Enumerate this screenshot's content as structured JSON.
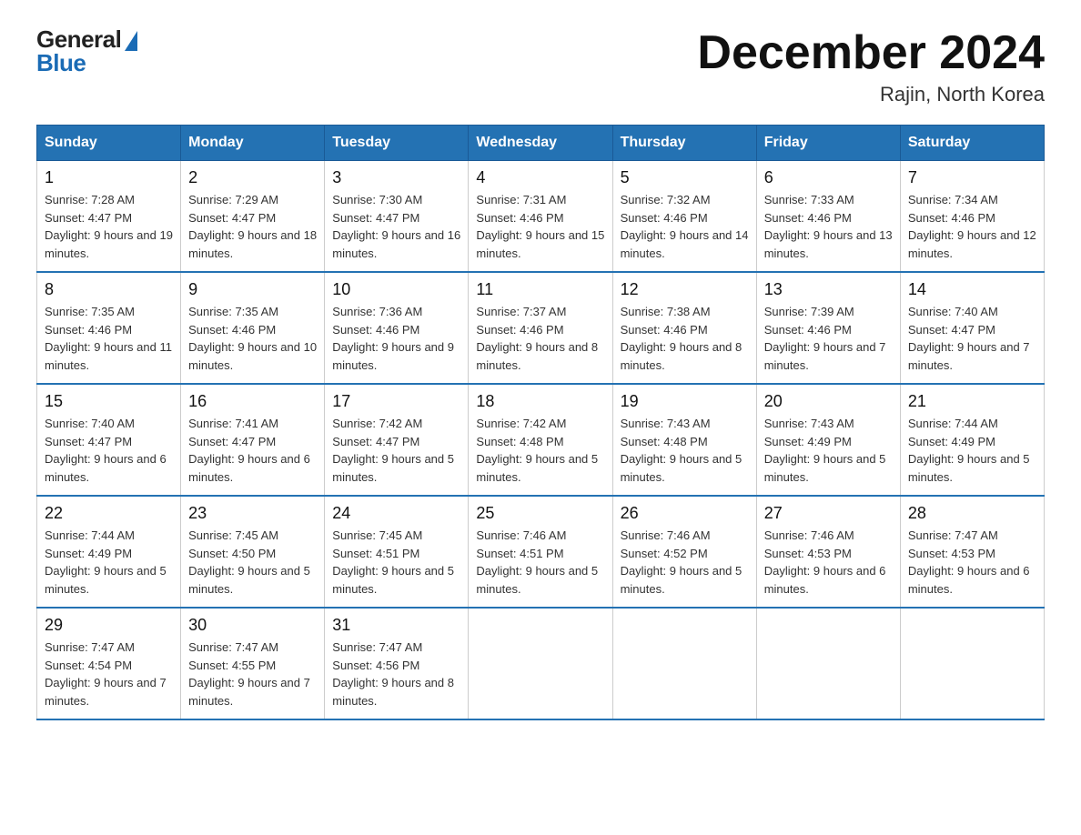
{
  "logo": {
    "general": "General",
    "blue": "Blue"
  },
  "title": "December 2024",
  "subtitle": "Rajin, North Korea",
  "days_of_week": [
    "Sunday",
    "Monday",
    "Tuesday",
    "Wednesday",
    "Thursday",
    "Friday",
    "Saturday"
  ],
  "weeks": [
    [
      {
        "day": "1",
        "sunrise": "7:28 AM",
        "sunset": "4:47 PM",
        "daylight": "9 hours and 19 minutes."
      },
      {
        "day": "2",
        "sunrise": "7:29 AM",
        "sunset": "4:47 PM",
        "daylight": "9 hours and 18 minutes."
      },
      {
        "day": "3",
        "sunrise": "7:30 AM",
        "sunset": "4:47 PM",
        "daylight": "9 hours and 16 minutes."
      },
      {
        "day": "4",
        "sunrise": "7:31 AM",
        "sunset": "4:46 PM",
        "daylight": "9 hours and 15 minutes."
      },
      {
        "day": "5",
        "sunrise": "7:32 AM",
        "sunset": "4:46 PM",
        "daylight": "9 hours and 14 minutes."
      },
      {
        "day": "6",
        "sunrise": "7:33 AM",
        "sunset": "4:46 PM",
        "daylight": "9 hours and 13 minutes."
      },
      {
        "day": "7",
        "sunrise": "7:34 AM",
        "sunset": "4:46 PM",
        "daylight": "9 hours and 12 minutes."
      }
    ],
    [
      {
        "day": "8",
        "sunrise": "7:35 AM",
        "sunset": "4:46 PM",
        "daylight": "9 hours and 11 minutes."
      },
      {
        "day": "9",
        "sunrise": "7:35 AM",
        "sunset": "4:46 PM",
        "daylight": "9 hours and 10 minutes."
      },
      {
        "day": "10",
        "sunrise": "7:36 AM",
        "sunset": "4:46 PM",
        "daylight": "9 hours and 9 minutes."
      },
      {
        "day": "11",
        "sunrise": "7:37 AM",
        "sunset": "4:46 PM",
        "daylight": "9 hours and 8 minutes."
      },
      {
        "day": "12",
        "sunrise": "7:38 AM",
        "sunset": "4:46 PM",
        "daylight": "9 hours and 8 minutes."
      },
      {
        "day": "13",
        "sunrise": "7:39 AM",
        "sunset": "4:46 PM",
        "daylight": "9 hours and 7 minutes."
      },
      {
        "day": "14",
        "sunrise": "7:40 AM",
        "sunset": "4:47 PM",
        "daylight": "9 hours and 7 minutes."
      }
    ],
    [
      {
        "day": "15",
        "sunrise": "7:40 AM",
        "sunset": "4:47 PM",
        "daylight": "9 hours and 6 minutes."
      },
      {
        "day": "16",
        "sunrise": "7:41 AM",
        "sunset": "4:47 PM",
        "daylight": "9 hours and 6 minutes."
      },
      {
        "day": "17",
        "sunrise": "7:42 AM",
        "sunset": "4:47 PM",
        "daylight": "9 hours and 5 minutes."
      },
      {
        "day": "18",
        "sunrise": "7:42 AM",
        "sunset": "4:48 PM",
        "daylight": "9 hours and 5 minutes."
      },
      {
        "day": "19",
        "sunrise": "7:43 AM",
        "sunset": "4:48 PM",
        "daylight": "9 hours and 5 minutes."
      },
      {
        "day": "20",
        "sunrise": "7:43 AM",
        "sunset": "4:49 PM",
        "daylight": "9 hours and 5 minutes."
      },
      {
        "day": "21",
        "sunrise": "7:44 AM",
        "sunset": "4:49 PM",
        "daylight": "9 hours and 5 minutes."
      }
    ],
    [
      {
        "day": "22",
        "sunrise": "7:44 AM",
        "sunset": "4:49 PM",
        "daylight": "9 hours and 5 minutes."
      },
      {
        "day": "23",
        "sunrise": "7:45 AM",
        "sunset": "4:50 PM",
        "daylight": "9 hours and 5 minutes."
      },
      {
        "day": "24",
        "sunrise": "7:45 AM",
        "sunset": "4:51 PM",
        "daylight": "9 hours and 5 minutes."
      },
      {
        "day": "25",
        "sunrise": "7:46 AM",
        "sunset": "4:51 PM",
        "daylight": "9 hours and 5 minutes."
      },
      {
        "day": "26",
        "sunrise": "7:46 AM",
        "sunset": "4:52 PM",
        "daylight": "9 hours and 5 minutes."
      },
      {
        "day": "27",
        "sunrise": "7:46 AM",
        "sunset": "4:53 PM",
        "daylight": "9 hours and 6 minutes."
      },
      {
        "day": "28",
        "sunrise": "7:47 AM",
        "sunset": "4:53 PM",
        "daylight": "9 hours and 6 minutes."
      }
    ],
    [
      {
        "day": "29",
        "sunrise": "7:47 AM",
        "sunset": "4:54 PM",
        "daylight": "9 hours and 7 minutes."
      },
      {
        "day": "30",
        "sunrise": "7:47 AM",
        "sunset": "4:55 PM",
        "daylight": "9 hours and 7 minutes."
      },
      {
        "day": "31",
        "sunrise": "7:47 AM",
        "sunset": "4:56 PM",
        "daylight": "9 hours and 8 minutes."
      },
      null,
      null,
      null,
      null
    ]
  ]
}
